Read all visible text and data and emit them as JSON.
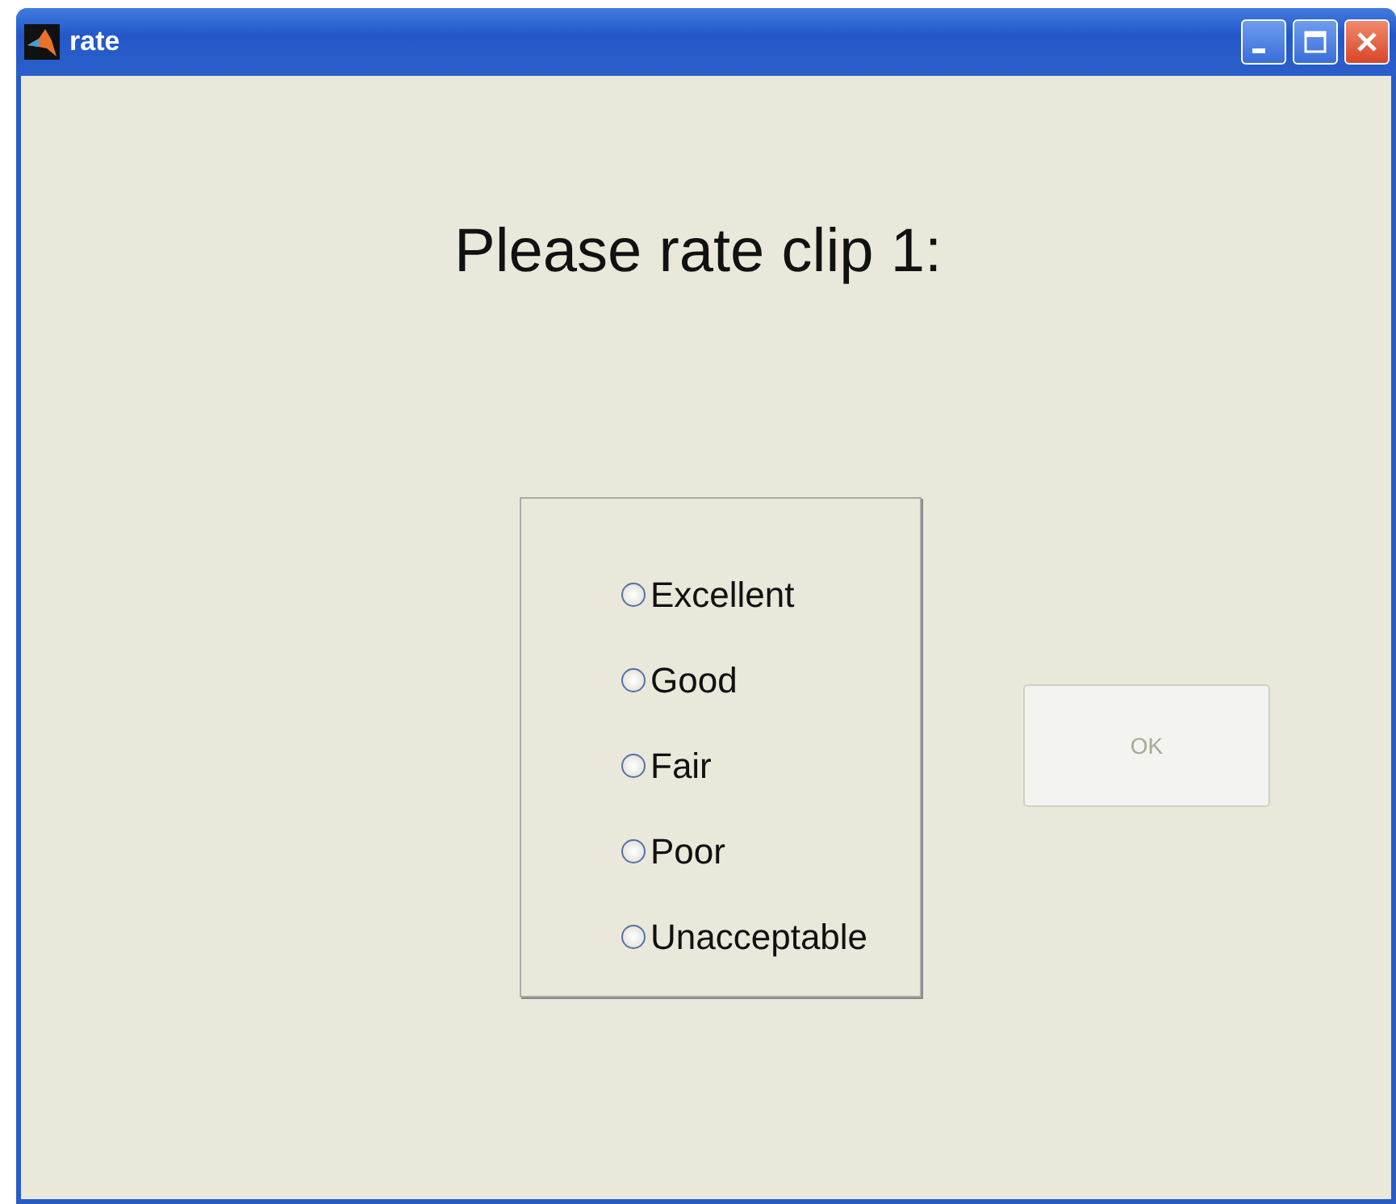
{
  "window": {
    "title": "rate"
  },
  "heading": "Please rate clip 1:",
  "options": [
    {
      "label": "Excellent",
      "selected": false
    },
    {
      "label": "Good",
      "selected": false
    },
    {
      "label": "Fair",
      "selected": false
    },
    {
      "label": "Poor",
      "selected": false
    },
    {
      "label": "Unacceptable",
      "selected": false
    }
  ],
  "ok_button": {
    "label": "OK",
    "disabled": true
  }
}
